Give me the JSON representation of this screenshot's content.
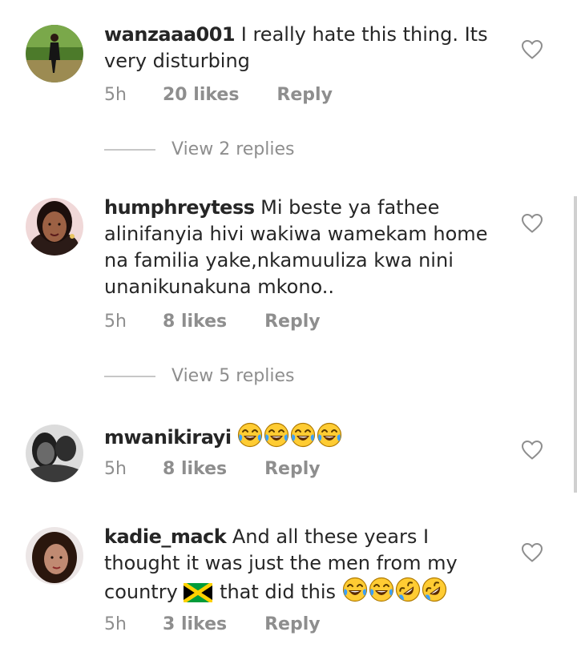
{
  "comments": [
    {
      "username": "wanzaaa001",
      "text": "I really hate this thing. Its very disturbing",
      "time": "5h",
      "likes": "20 likes",
      "reply": "Reply",
      "view_replies": "View 2 replies"
    },
    {
      "username": "humphreytess",
      "text": "Mi beste ya fathee alinifanyia hivi wakiwa wamekam home na familia yake,nkamuuliza kwa nini unanikunakuna mkono..",
      "time": "5h",
      "likes": "8 likes",
      "reply": "Reply",
      "view_replies": "View 5 replies"
    },
    {
      "username": "mwanikirayi",
      "text": "",
      "time": "5h",
      "likes": "8 likes",
      "reply": "Reply"
    },
    {
      "username": "kadie_mack",
      "text_line1": "And all these years I thought it was just the men from my country",
      "text_line2": "that did this",
      "time": "5h",
      "likes": "3 likes",
      "reply": "Reply"
    }
  ],
  "icons": {
    "heart": "heart-outline-icon",
    "laugh": "face-with-tears-of-joy-emoji",
    "rofl": "rolling-on-the-floor-laughing-emoji",
    "flag": "jamaica-flag-emoji"
  },
  "colors": {
    "text": "#262626",
    "secondary": "#8e8e8e",
    "divider": "#c7c7c7"
  }
}
